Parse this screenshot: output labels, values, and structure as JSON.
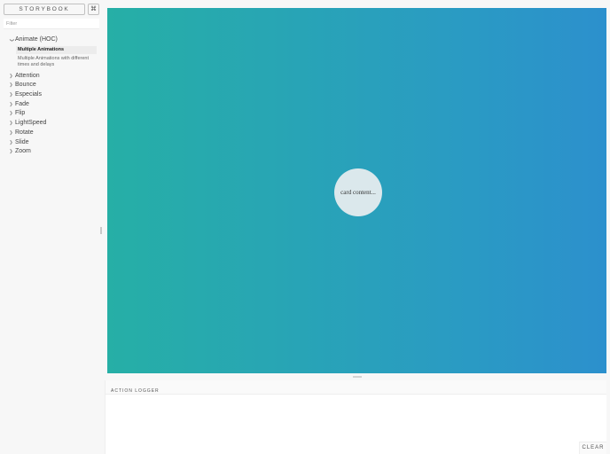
{
  "sidebar": {
    "brand": "STORYBOOK",
    "shortcut_icon": "⌘",
    "filter_placeholder": "Filter",
    "kinds": [
      {
        "label": "Animate (HOC)",
        "expanded": true,
        "stories": [
          "Multiple Animations",
          "Multiple Animations with different times and delays"
        ]
      },
      {
        "label": "Attention",
        "expanded": false
      },
      {
        "label": "Bounce",
        "expanded": false
      },
      {
        "label": "Especials",
        "expanded": false
      },
      {
        "label": "Fade",
        "expanded": false
      },
      {
        "label": "Flip",
        "expanded": false
      },
      {
        "label": "LightSpeed",
        "expanded": false
      },
      {
        "label": "Rotate",
        "expanded": false
      },
      {
        "label": "Slide",
        "expanded": false
      },
      {
        "label": "Zoom",
        "expanded": false
      }
    ]
  },
  "preview": {
    "card_text": "card content..."
  },
  "panel": {
    "tab": "ACTION LOGGER",
    "clear_label": "CLEAR"
  },
  "colors": {
    "preview_start": "#26afa6",
    "preview_end": "#2c90cd",
    "card": "#dbe8ec"
  }
}
